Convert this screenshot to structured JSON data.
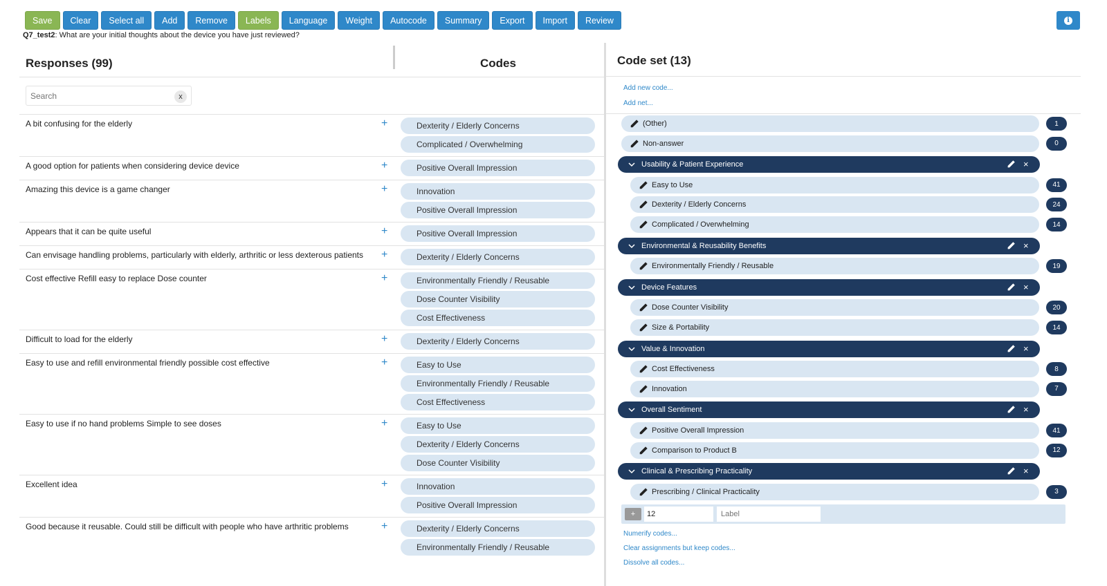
{
  "toolbar": {
    "buttons": [
      {
        "label": "Save",
        "style": "green"
      },
      {
        "label": "Clear",
        "style": "blue"
      },
      {
        "label": "Select all",
        "style": "blue"
      },
      {
        "label": "Add",
        "style": "blue"
      },
      {
        "label": "Remove",
        "style": "blue"
      },
      {
        "label": "Labels",
        "style": "green"
      },
      {
        "label": "Language",
        "style": "blue"
      },
      {
        "label": "Weight",
        "style": "blue"
      },
      {
        "label": "Autocode",
        "style": "blue"
      },
      {
        "label": "Summary",
        "style": "blue"
      },
      {
        "label": "Export",
        "style": "blue"
      },
      {
        "label": "Import",
        "style": "blue"
      },
      {
        "label": "Review",
        "style": "blue"
      }
    ],
    "info_icon": "info-icon"
  },
  "question": {
    "id": "Q7_test2",
    "text": ": What are your initial thoughts about the device you have just reviewed?"
  },
  "responses": {
    "title": "Responses (99)",
    "codes_title": "Codes",
    "search_placeholder": "Search",
    "search_clear": "x",
    "rows": [
      {
        "text": "A bit confusing for the elderly",
        "codes": [
          "Dexterity / Elderly Concerns",
          "Complicated / Overwhelming"
        ]
      },
      {
        "text": "A good option for patients when considering device device",
        "codes": [
          "Positive Overall Impression"
        ]
      },
      {
        "text": "Amazing this device is a game changer",
        "codes": [
          "Innovation",
          "Positive Overall Impression"
        ]
      },
      {
        "text": "Appears that it can be quite useful",
        "codes": [
          "Positive Overall Impression"
        ]
      },
      {
        "text": "Can envisage handling problems, particularly with elderly, arthritic or less dexterous patients",
        "codes": [
          "Dexterity / Elderly Concerns"
        ]
      },
      {
        "text": "Cost effective Refill easy to replace Dose counter",
        "codes": [
          "Environmentally Friendly / Reusable",
          "Dose Counter Visibility",
          "Cost Effectiveness"
        ]
      },
      {
        "text": "Difficult to load for the elderly",
        "codes": [
          "Dexterity / Elderly Concerns"
        ]
      },
      {
        "text": "Easy to use and refill environmental friendly possible cost effective",
        "codes": [
          "Easy to Use",
          "Environmentally Friendly / Reusable",
          "Cost Effectiveness"
        ]
      },
      {
        "text": "Easy to use if no hand problems Simple to see doses",
        "codes": [
          "Easy to Use",
          "Dexterity / Elderly Concerns",
          "Dose Counter Visibility"
        ]
      },
      {
        "text": "Excellent idea",
        "codes": [
          "Innovation",
          "Positive Overall Impression"
        ]
      },
      {
        "text": "Good because it reusable. Could still be difficult with people who have arthritic problems",
        "codes": [
          "Dexterity / Elderly Concerns",
          "Environmentally Friendly / Reusable"
        ]
      }
    ]
  },
  "codeset": {
    "title": "Code set (13)",
    "add_new_code": "Add new code...",
    "add_net": "Add net...",
    "other": {
      "label": "(Other)",
      "count": "1"
    },
    "nonanswer": {
      "label": "Non-answer",
      "count": "0"
    },
    "groups": [
      {
        "label": "Usability & Patient Experience",
        "items": [
          {
            "label": "Easy to Use",
            "count": "41"
          },
          {
            "label": "Dexterity / Elderly Concerns",
            "count": "24"
          },
          {
            "label": "Complicated / Overwhelming",
            "count": "14"
          }
        ]
      },
      {
        "label": "Environmental & Reusability Benefits",
        "items": [
          {
            "label": "Environmentally Friendly / Reusable",
            "count": "19"
          }
        ]
      },
      {
        "label": "Device Features",
        "items": [
          {
            "label": "Dose Counter Visibility",
            "count": "20"
          },
          {
            "label": "Size & Portability",
            "count": "14"
          }
        ]
      },
      {
        "label": "Value & Innovation",
        "items": [
          {
            "label": "Cost Effectiveness",
            "count": "8"
          },
          {
            "label": "Innovation",
            "count": "7"
          }
        ]
      },
      {
        "label": "Overall Sentiment",
        "items": [
          {
            "label": "Positive Overall Impression",
            "count": "41"
          },
          {
            "label": "Comparison to Product B",
            "count": "12"
          }
        ]
      },
      {
        "label": "Clinical & Prescribing Practicality",
        "items": [
          {
            "label": "Prescribing / Clinical Practicality",
            "count": "3"
          }
        ]
      }
    ],
    "new_code": {
      "add": "+",
      "number": "12",
      "label_placeholder": "Label"
    },
    "numerify": "Numerify codes...",
    "clear_assignments": "Clear assignments but keep codes...",
    "dissolve": "Dissolve all codes..."
  },
  "colors": {
    "blue": "#2f88c9",
    "green": "#8ab654",
    "navy": "#1f3a5f",
    "chip": "#d9e6f2"
  }
}
